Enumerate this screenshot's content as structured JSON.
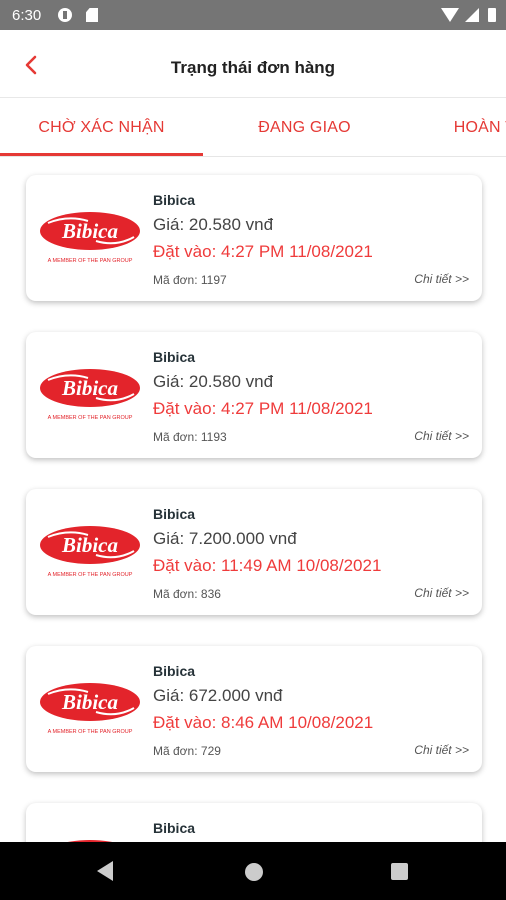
{
  "status_bar": {
    "time": "6:30"
  },
  "header": {
    "title": "Trạng thái đơn hàng"
  },
  "tabs": [
    {
      "label": "CHỜ XÁC NHẬN",
      "active": true
    },
    {
      "label": "ĐANG GIAO",
      "active": false
    },
    {
      "label": "HOÀN THÀNH",
      "active": false
    }
  ],
  "logo": {
    "brand": "Bibica",
    "tagline": "A MEMBER OF THE PAN GROUP"
  },
  "orders": [
    {
      "shop": "Bibica",
      "price": "Giá: 20.580 vnđ",
      "placed": "Đặt vào: 4:27 PM  11/08/2021",
      "code": "Mã đơn: 1197",
      "detail": "Chi tiết >>"
    },
    {
      "shop": "Bibica",
      "price": "Giá: 20.580 vnđ",
      "placed": "Đặt vào: 4:27 PM  11/08/2021",
      "code": "Mã đơn: 1193",
      "detail": "Chi tiết >>"
    },
    {
      "shop": "Bibica",
      "price": "Giá: 7.200.000 vnđ",
      "placed": "Đặt vào: 11:49 AM  10/08/2021",
      "code": "Mã đơn: 836",
      "detail": "Chi tiết >>"
    },
    {
      "shop": "Bibica",
      "price": "Giá: 672.000 vnđ",
      "placed": "Đặt vào: 8:46 AM  10/08/2021",
      "code": "Mã đơn: 729",
      "detail": "Chi tiết >>"
    },
    {
      "shop": "Bibica"
    }
  ],
  "colors": {
    "accent": "#e53935",
    "brand_red": "#e3242b"
  }
}
